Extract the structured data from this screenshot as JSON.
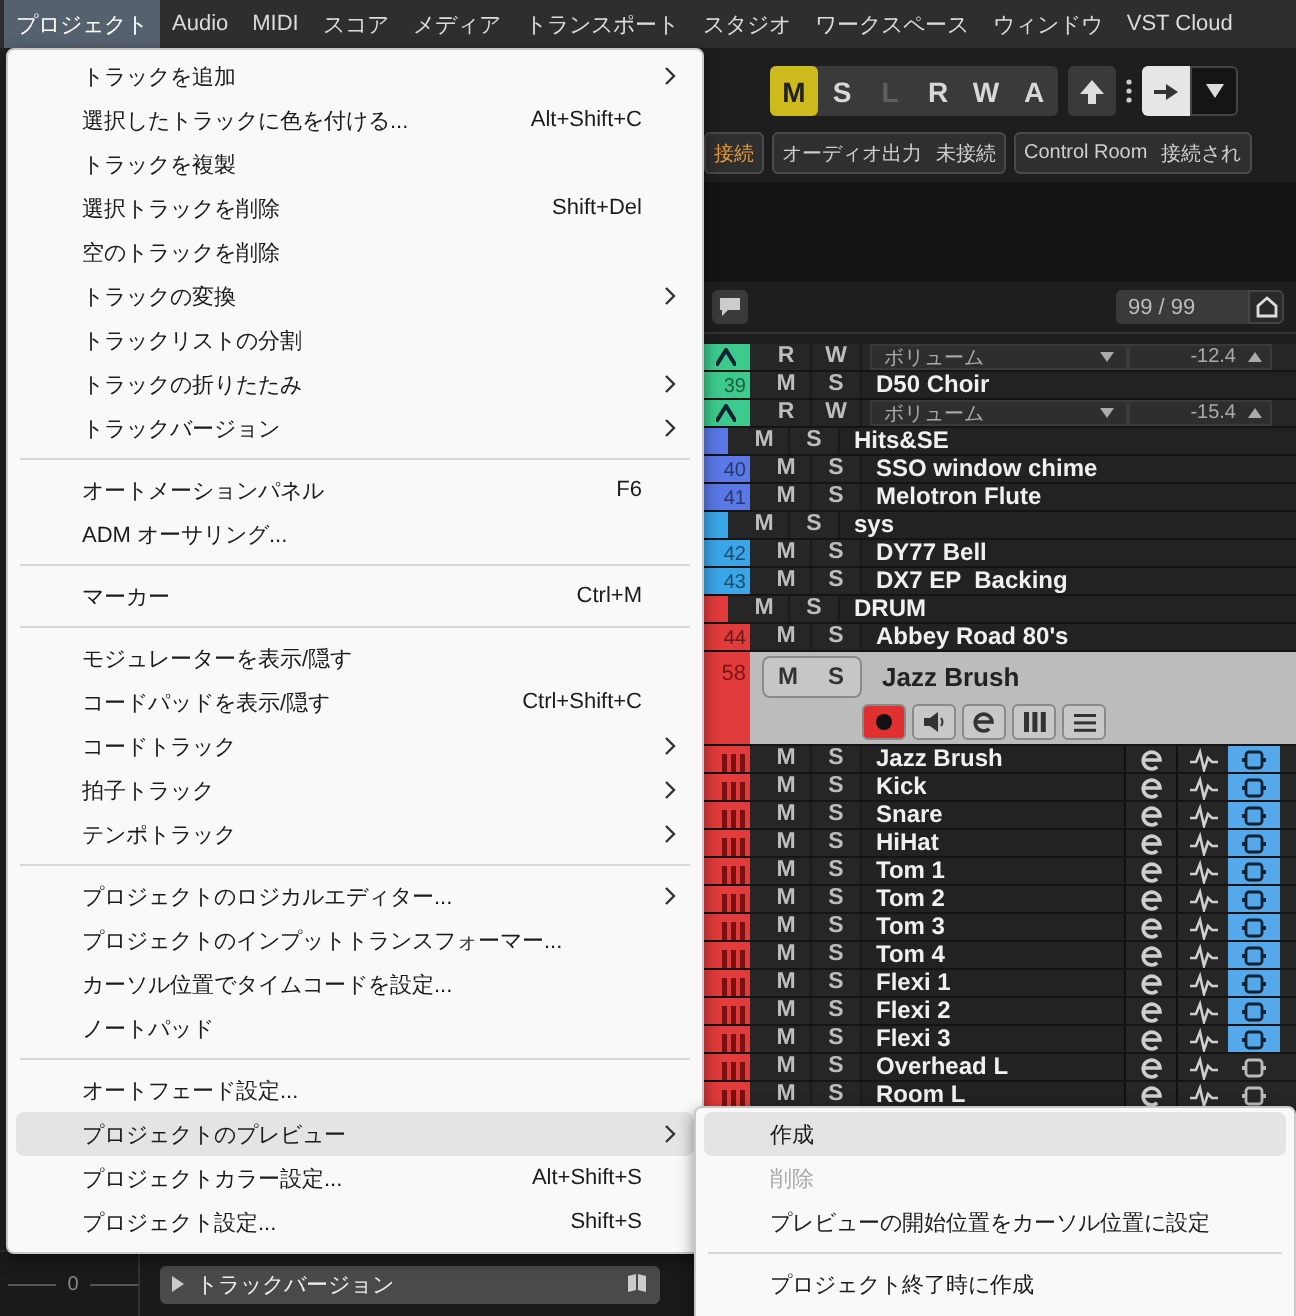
{
  "menubar": [
    {
      "label": "プロジェクト",
      "selected": true
    },
    {
      "label": "Audio",
      "selected": false
    },
    {
      "label": "MIDI",
      "selected": false
    },
    {
      "label": "スコア",
      "selected": false
    },
    {
      "label": "メディア",
      "selected": false
    },
    {
      "label": "トランスポート",
      "selected": false
    },
    {
      "label": "スタジオ",
      "selected": false
    },
    {
      "label": "ワークスペース",
      "selected": false
    },
    {
      "label": "ウィンドウ",
      "selected": false
    },
    {
      "label": "VST Cloud",
      "selected": false
    }
  ],
  "toolbar": {
    "buttons": [
      {
        "label": "M",
        "on": true,
        "disabled": false
      },
      {
        "label": "S",
        "on": false,
        "disabled": false
      },
      {
        "label": "L",
        "on": false,
        "disabled": true
      },
      {
        "label": "R",
        "on": false,
        "disabled": false
      },
      {
        "label": "W",
        "on": false,
        "disabled": false
      },
      {
        "label": "A",
        "on": false,
        "disabled": false
      }
    ]
  },
  "connections": [
    {
      "parts": [
        {
          "text": "接続",
          "warning": true
        }
      ]
    },
    {
      "parts": [
        {
          "text": "オーディオ出力",
          "warning": false
        },
        {
          "text": "未接続",
          "warning": false
        }
      ]
    },
    {
      "parts": [
        {
          "text": "Control Room",
          "warning": false
        },
        {
          "text": "接続され",
          "warning": false
        }
      ]
    }
  ],
  "track_count": "99 / 99",
  "tracks": [
    {
      "kind": "automation",
      "color": "#3ccb8c",
      "read": "R",
      "write": "W",
      "parameter": "ボリューム",
      "value": "-12.4"
    },
    {
      "kind": "track",
      "number": "39",
      "color": "#3ccb8c",
      "mute": "M",
      "solo": "S",
      "name": "D50 Choir",
      "selected": false
    },
    {
      "kind": "automation",
      "color": "#3ccb8c",
      "read": "R",
      "write": "W",
      "parameter": "ボリューム",
      "value": "-15.4"
    },
    {
      "kind": "folder",
      "color": "#5a78e6",
      "mute": "M",
      "solo": "S",
      "name": "Hits&SE",
      "selected": false
    },
    {
      "kind": "track",
      "number": "40",
      "color": "#5a78e6",
      "mute": "M",
      "solo": "S",
      "name": "SSO window chime",
      "selected": false
    },
    {
      "kind": "track",
      "number": "41",
      "color": "#5a78e6",
      "mute": "M",
      "solo": "S",
      "name": "Melotron Flute",
      "selected": false
    },
    {
      "kind": "folder",
      "color": "#3aa6e8",
      "mute": "M",
      "solo": "S",
      "name": "sys",
      "selected": false
    },
    {
      "kind": "track",
      "number": "42",
      "color": "#3aa6e8",
      "mute": "M",
      "solo": "S",
      "name": "DY77 Bell",
      "selected": false
    },
    {
      "kind": "track",
      "number": "43",
      "color": "#3aa6e8",
      "mute": "M",
      "solo": "S",
      "name": "DX7 EP  Backing",
      "selected": false
    },
    {
      "kind": "folder",
      "color": "#e23b3b",
      "mute": "M",
      "solo": "S",
      "name": "DRUM",
      "selected": false
    },
    {
      "kind": "track",
      "number": "44",
      "color": "#e23b3b",
      "mute": "M",
      "solo": "S",
      "name": "Abbey Road 80's",
      "selected": false
    },
    {
      "kind": "track",
      "number": "58",
      "color": "#e23b3b",
      "mute": "M",
      "solo": "S",
      "name": "Jazz Brush",
      "selected": true
    },
    {
      "kind": "drum",
      "color": "#e23b3b",
      "mute": "M",
      "solo": "S",
      "name": "Jazz Brush",
      "monitor": true,
      "selected": false
    },
    {
      "kind": "drum",
      "color": "#e23b3b",
      "mute": "M",
      "solo": "S",
      "name": "Kick",
      "monitor": true,
      "selected": false
    },
    {
      "kind": "drum",
      "color": "#e23b3b",
      "mute": "M",
      "solo": "S",
      "name": "Snare",
      "monitor": true,
      "selected": false
    },
    {
      "kind": "drum",
      "color": "#e23b3b",
      "mute": "M",
      "solo": "S",
      "name": "HiHat",
      "monitor": true,
      "selected": false
    },
    {
      "kind": "drum",
      "color": "#e23b3b",
      "mute": "M",
      "solo": "S",
      "name": "Tom 1",
      "monitor": true,
      "selected": false
    },
    {
      "kind": "drum",
      "color": "#e23b3b",
      "mute": "M",
      "solo": "S",
      "name": "Tom 2",
      "monitor": true,
      "selected": false
    },
    {
      "kind": "drum",
      "color": "#e23b3b",
      "mute": "M",
      "solo": "S",
      "name": "Tom 3",
      "monitor": true,
      "selected": false
    },
    {
      "kind": "drum",
      "color": "#e23b3b",
      "mute": "M",
      "solo": "S",
      "name": "Tom 4",
      "monitor": true,
      "selected": false
    },
    {
      "kind": "drum",
      "color": "#e23b3b",
      "mute": "M",
      "solo": "S",
      "name": "Flexi 1",
      "monitor": true,
      "selected": false
    },
    {
      "kind": "drum",
      "color": "#e23b3b",
      "mute": "M",
      "solo": "S",
      "name": "Flexi 2",
      "monitor": true,
      "selected": false
    },
    {
      "kind": "drum",
      "color": "#e23b3b",
      "mute": "M",
      "solo": "S",
      "name": "Flexi 3",
      "monitor": true,
      "selected": false
    },
    {
      "kind": "drum",
      "color": "#e23b3b",
      "mute": "M",
      "solo": "S",
      "name": "Overhead L",
      "monitor": false,
      "selected": false
    },
    {
      "kind": "drum",
      "color": "#e23b3b",
      "mute": "M",
      "solo": "S",
      "name": "Room L",
      "monitor": false,
      "selected": false
    }
  ],
  "bottom_bar": {
    "fader_value": "0",
    "track_version_button": "トラックバージョン"
  },
  "project_menu": [
    {
      "kind": "item",
      "label": "トラックを追加",
      "submenu": true,
      "selected": false
    },
    {
      "kind": "item",
      "label": "選択したトラックに色を付ける...",
      "shortcut": "Alt+Shift+C",
      "submenu": false,
      "selected": false
    },
    {
      "kind": "item",
      "label": "トラックを複製",
      "submenu": false,
      "selected": false
    },
    {
      "kind": "item",
      "label": "選択トラックを削除",
      "shortcut": "Shift+Del",
      "submenu": false,
      "selected": false
    },
    {
      "kind": "item",
      "label": "空のトラックを削除",
      "submenu": false,
      "selected": false
    },
    {
      "kind": "item",
      "label": "トラックの変換",
      "submenu": true,
      "selected": false
    },
    {
      "kind": "item",
      "label": "トラックリストの分割",
      "submenu": false,
      "selected": false
    },
    {
      "kind": "item",
      "label": "トラックの折りたたみ",
      "submenu": true,
      "selected": false
    },
    {
      "kind": "item",
      "label": "トラックバージョン",
      "submenu": true,
      "selected": false
    },
    {
      "kind": "separator"
    },
    {
      "kind": "item",
      "label": "オートメーションパネル",
      "shortcut": "F6",
      "submenu": false,
      "selected": false
    },
    {
      "kind": "item",
      "label": "ADM オーサリング...",
      "submenu": false,
      "selected": false
    },
    {
      "kind": "separator"
    },
    {
      "kind": "item",
      "label": "マーカー",
      "shortcut": "Ctrl+M",
      "submenu": false,
      "selected": false
    },
    {
      "kind": "separator"
    },
    {
      "kind": "item",
      "label": "モジュレーターを表示/隠す",
      "submenu": false,
      "selected": false
    },
    {
      "kind": "item",
      "label": "コードパッドを表示/隠す",
      "shortcut": "Ctrl+Shift+C",
      "submenu": false,
      "selected": false
    },
    {
      "kind": "item",
      "label": "コードトラック",
      "submenu": true,
      "selected": false
    },
    {
      "kind": "item",
      "label": "拍子トラック",
      "submenu": true,
      "selected": false
    },
    {
      "kind": "item",
      "label": "テンポトラック",
      "submenu": true,
      "selected": false
    },
    {
      "kind": "separator"
    },
    {
      "kind": "item",
      "label": "プロジェクトのロジカルエディター...",
      "submenu": true,
      "selected": false
    },
    {
      "kind": "item",
      "label": "プロジェクトのインプットトランスフォーマー...",
      "submenu": false,
      "selected": false
    },
    {
      "kind": "item",
      "label": "カーソル位置でタイムコードを設定...",
      "submenu": false,
      "selected": false
    },
    {
      "kind": "item",
      "label": "ノートパッド",
      "submenu": false,
      "selected": false
    },
    {
      "kind": "separator"
    },
    {
      "kind": "item",
      "label": "オートフェード設定...",
      "submenu": false,
      "selected": false
    },
    {
      "kind": "item",
      "label": "プロジェクトのプレビュー",
      "submenu": true,
      "selected": true
    },
    {
      "kind": "item",
      "label": "プロジェクトカラー設定...",
      "shortcut": "Alt+Shift+S",
      "submenu": false,
      "selected": false
    },
    {
      "kind": "item",
      "label": "プロジェクト設定...",
      "shortcut": "Shift+S",
      "submenu": false,
      "selected": false
    }
  ],
  "preview_submenu": [
    {
      "kind": "item",
      "label": "作成",
      "selected": true,
      "disabled": false
    },
    {
      "kind": "item",
      "label": "削除",
      "selected": false,
      "disabled": true
    },
    {
      "kind": "item",
      "label": "プレビューの開始位置をカーソル位置に設定",
      "selected": false,
      "disabled": false
    },
    {
      "kind": "separator"
    },
    {
      "kind": "item",
      "label": "プロジェクト終了時に作成",
      "selected": false,
      "disabled": false
    }
  ]
}
